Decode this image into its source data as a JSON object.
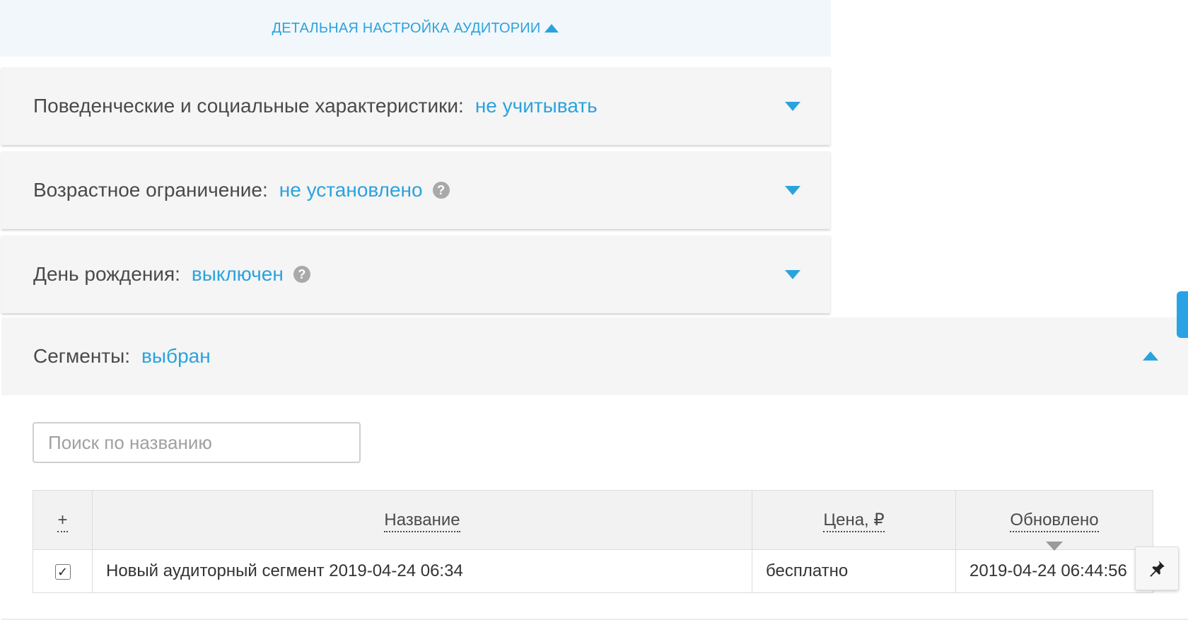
{
  "header": {
    "title": "ДЕТАЛЬНАЯ НАСТРОЙКА АУДИТОРИИ"
  },
  "sections": [
    {
      "label": "Поведенческие и социальные характеристики:",
      "value": "не учитывать"
    },
    {
      "label": "Возрастное ограничение:",
      "value": "не установлено",
      "help": "?"
    },
    {
      "label": "День рождения:",
      "value": "выключен",
      "help": "?"
    }
  ],
  "segments": {
    "label": "Сегменты:",
    "value": "выбран",
    "search_placeholder": "Поиск по названию",
    "table": {
      "columns": [
        "+",
        "Название",
        "Цена, ₽",
        "Обновлено"
      ],
      "rows": [
        {
          "checked": true,
          "check_mark": "✓",
          "name": "Новый аудиторный сегмент 2019-04-24 06:34",
          "price": "бесплатно",
          "updated": "2019-04-24 06:44:56"
        }
      ]
    }
  },
  "colors": {
    "accent": "#2aa3dd",
    "row_bg": "#f5f5f5",
    "header_bg": "#f2f7fb"
  },
  "icons": {
    "help": "question-circle-icon",
    "expand": "caret-down-icon",
    "collapse": "caret-up-icon",
    "pin": "pin-icon"
  }
}
